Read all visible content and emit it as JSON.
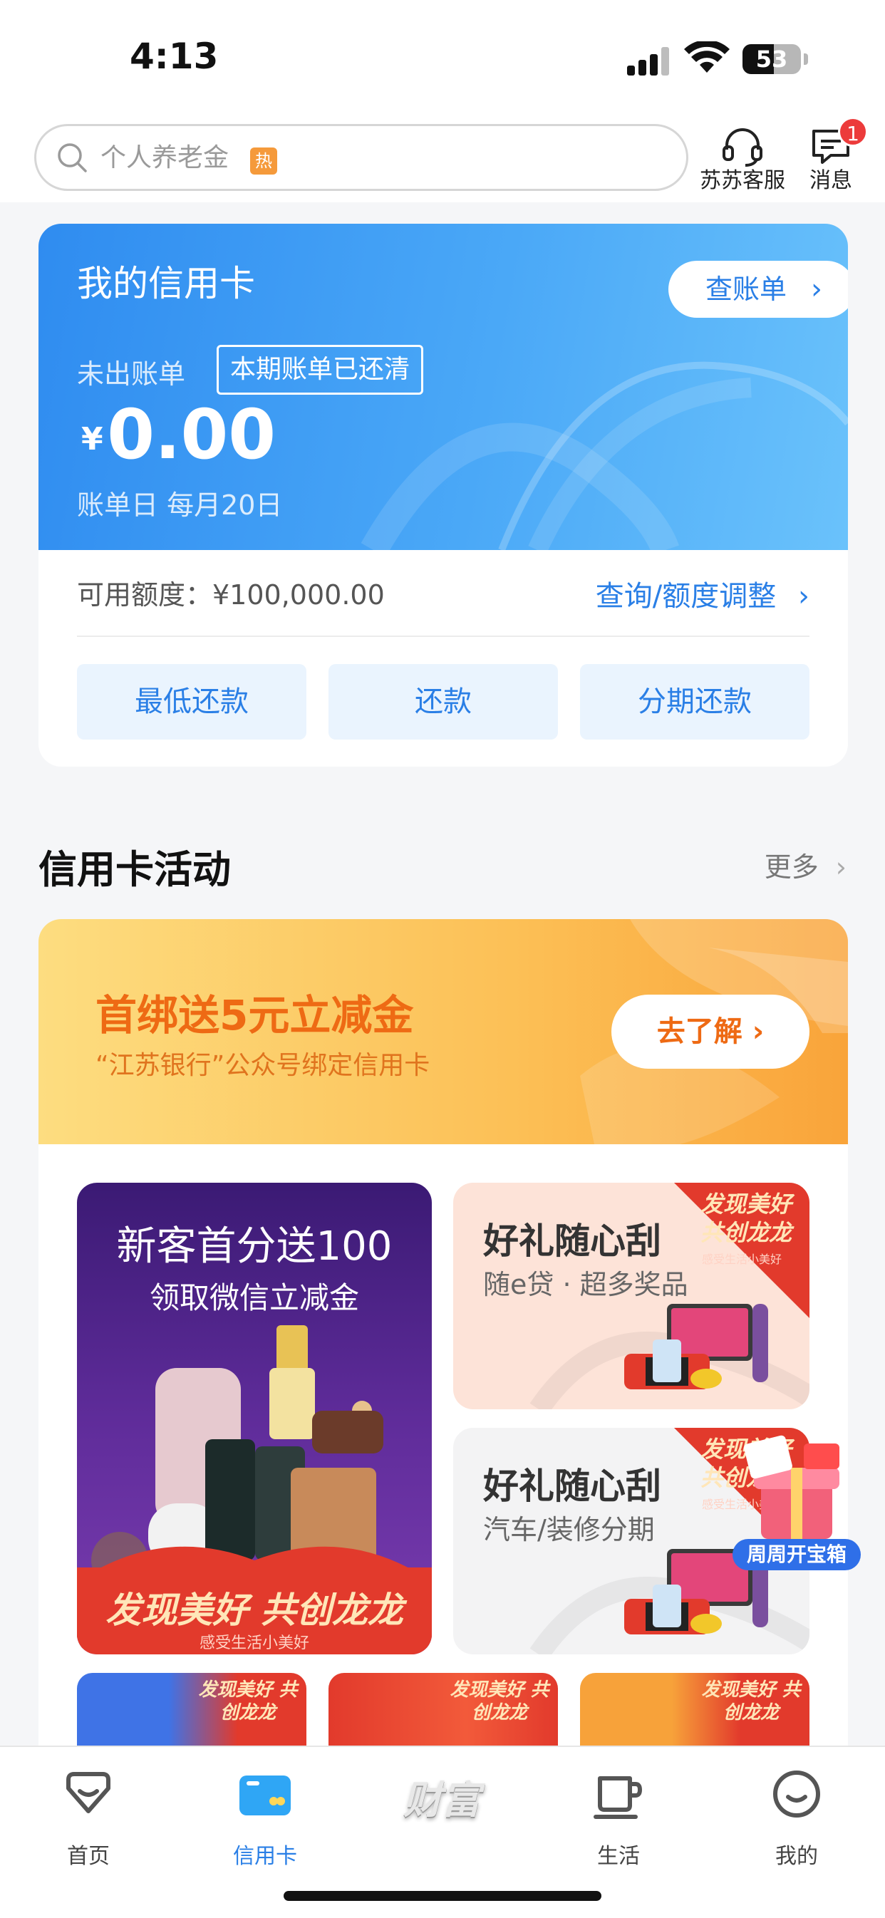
{
  "status_bar": {
    "time": "4:13",
    "battery": "53"
  },
  "header": {
    "search_placeholder": "个人养老金",
    "hot_tag": "热",
    "service_label": "苏苏客服",
    "message_label": "消息",
    "message_badge": "1"
  },
  "credit_card": {
    "title": "我的信用卡",
    "bill_button": "查账单",
    "unbilled_label": "未出账单",
    "paid_tag": "本期账单已还清",
    "currency": "¥",
    "amount": "0.00",
    "bill_day": "账单日 每月20日",
    "available_credit": "可用额度：¥100,000.00",
    "adjust_link": "查询/额度调整",
    "actions": [
      "最低还款",
      "还款",
      "分期还款"
    ]
  },
  "activities": {
    "title": "信用卡活动",
    "more": "更多",
    "banner": {
      "title": "首绑送5元立减金",
      "subtitle": "“江苏银行”公众号绑定信用卡",
      "button": "去了解"
    },
    "big_tile": {
      "title": "新客首分送100",
      "subtitle": "领取微信立减金",
      "slogan": "发现美好 共创龙龙",
      "slogan_sub": "感受生活小美好"
    },
    "small_tiles": [
      {
        "title": "好礼随心刮",
        "subtitle": "随e贷 · 超多奖品",
        "corner": "发现美好 共创龙龙",
        "corner_sub": "感受生活小美好"
      },
      {
        "title": "好礼随心刮",
        "subtitle": "汽车/装修分期",
        "corner": "发现美好 共创龙龙",
        "corner_sub": "感受生活小美好"
      }
    ],
    "strip_labels": [
      "发现美好 共创龙龙",
      "发现美好 共创龙龙",
      "发现美好 共创龙龙"
    ],
    "floating_label": "周周开宝箱"
  },
  "tabbar": {
    "items": [
      "首页",
      "信用卡",
      "生活",
      "我的"
    ],
    "center_logo": "财富"
  },
  "colors": {
    "accent": "#2a7fe6",
    "orange": "#ee6a14",
    "red": "#e23a2c"
  }
}
